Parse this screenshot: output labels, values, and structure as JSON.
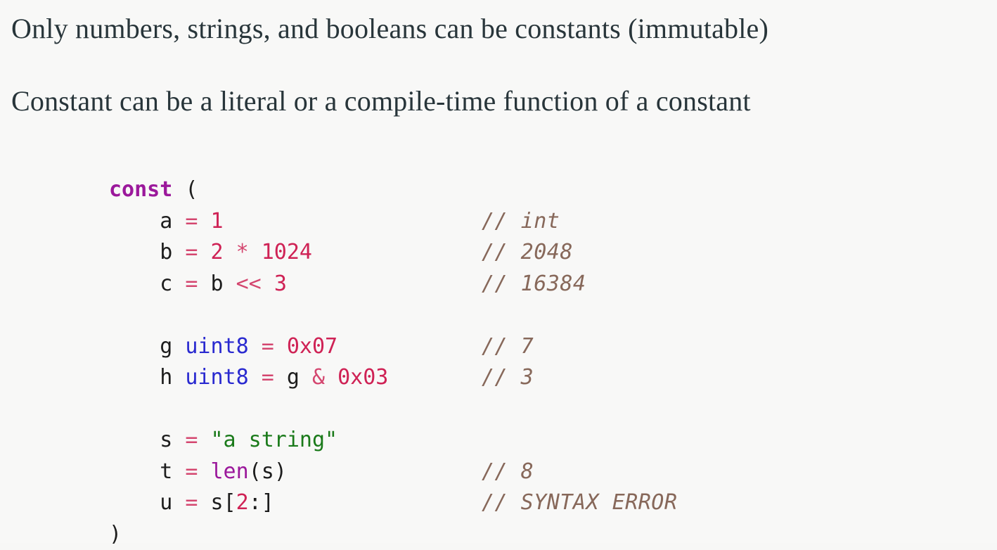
{
  "slide": {
    "background_color": "#f8f8f7",
    "prose": [
      "Only numbers, strings, and booleans can be constants (immutable)",
      "Constant can be a literal or a compile-time function of a constant"
    ]
  },
  "colors": {
    "keyword": "#9b189b",
    "identifier": "#1d1d1d",
    "type": "#2a2ad0",
    "number": "#cf2255",
    "operator": "#d4466f",
    "string": "#1a7a1a",
    "comment": "#87685a",
    "heading": "#28353a",
    "background": "#f8f8f7"
  },
  "code": {
    "language": "go",
    "lines": [
      {
        "indent": 0,
        "tokens": [
          {
            "t": "kw",
            "v": "const"
          },
          {
            "t": "punct",
            "v": " ("
          }
        ],
        "comment": ""
      },
      {
        "indent": 1,
        "tokens": [
          {
            "t": "ident",
            "v": "a"
          },
          {
            "t": "op",
            "v": " = "
          },
          {
            "t": "num",
            "v": "1"
          }
        ],
        "comment": "// int"
      },
      {
        "indent": 1,
        "tokens": [
          {
            "t": "ident",
            "v": "b"
          },
          {
            "t": "op",
            "v": " = "
          },
          {
            "t": "num",
            "v": "2"
          },
          {
            "t": "op",
            "v": " * "
          },
          {
            "t": "num",
            "v": "1024"
          }
        ],
        "comment": "// 2048"
      },
      {
        "indent": 1,
        "tokens": [
          {
            "t": "ident",
            "v": "c"
          },
          {
            "t": "op",
            "v": " = "
          },
          {
            "t": "ident",
            "v": "b"
          },
          {
            "t": "op",
            "v": " << "
          },
          {
            "t": "num",
            "v": "3"
          }
        ],
        "comment": "// 16384"
      },
      {
        "indent": 0,
        "tokens": [],
        "comment": ""
      },
      {
        "indent": 1,
        "tokens": [
          {
            "t": "ident",
            "v": "g "
          },
          {
            "t": "type",
            "v": "uint8"
          },
          {
            "t": "op",
            "v": " = "
          },
          {
            "t": "num",
            "v": "0x07"
          }
        ],
        "comment": "// 7"
      },
      {
        "indent": 1,
        "tokens": [
          {
            "t": "ident",
            "v": "h "
          },
          {
            "t": "type",
            "v": "uint8"
          },
          {
            "t": "op",
            "v": " = "
          },
          {
            "t": "ident",
            "v": "g"
          },
          {
            "t": "op",
            "v": " & "
          },
          {
            "t": "num",
            "v": "0x03"
          }
        ],
        "comment": "// 3"
      },
      {
        "indent": 0,
        "tokens": [],
        "comment": ""
      },
      {
        "indent": 1,
        "tokens": [
          {
            "t": "ident",
            "v": "s"
          },
          {
            "t": "op",
            "v": " = "
          },
          {
            "t": "str",
            "v": "\"a string\""
          }
        ],
        "comment": ""
      },
      {
        "indent": 1,
        "tokens": [
          {
            "t": "ident",
            "v": "t"
          },
          {
            "t": "op",
            "v": " = "
          },
          {
            "t": "fn",
            "v": "len"
          },
          {
            "t": "punct",
            "v": "("
          },
          {
            "t": "ident",
            "v": "s"
          },
          {
            "t": "punct",
            "v": ")"
          }
        ],
        "comment": "// 8"
      },
      {
        "indent": 1,
        "tokens": [
          {
            "t": "ident",
            "v": "u"
          },
          {
            "t": "op",
            "v": " = "
          },
          {
            "t": "ident",
            "v": "s"
          },
          {
            "t": "punct",
            "v": "["
          },
          {
            "t": "num",
            "v": "2"
          },
          {
            "t": "punct",
            "v": ":]"
          }
        ],
        "comment": "// SYNTAX ERROR"
      },
      {
        "indent": 0,
        "tokens": [
          {
            "t": "punct",
            "v": ")"
          }
        ],
        "comment": ""
      }
    ]
  }
}
